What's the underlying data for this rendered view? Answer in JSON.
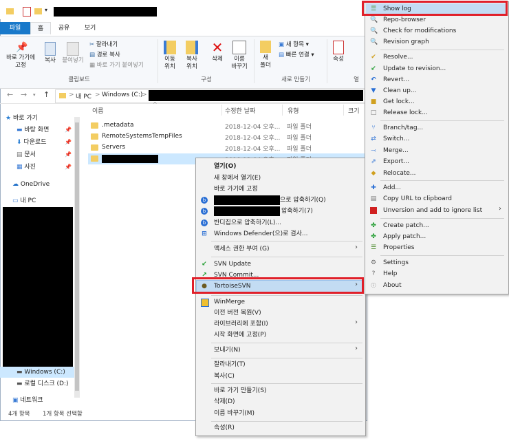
{
  "ribbon": {
    "tabs": [
      "파일",
      "홈",
      "공유",
      "보기"
    ],
    "pin_label": "바로 가기에\n고정",
    "copy_label": "복사",
    "paste_label": "붙여넣기",
    "cut_label": "잘라내기",
    "copy_path_label": "경로 복사",
    "paste_shortcut_label": "바로 가기 붙여넣기",
    "clipboard_group": "클립보드",
    "move_label": "이동\n위치",
    "copyto_label": "복사\n위치",
    "delete_label": "삭제",
    "rename_label": "이름\n바꾸기",
    "organize_group": "구성",
    "new_folder_label": "새\n폴더",
    "new_item_label": "새 항목",
    "easy_access_label": "빠른 연결",
    "new_group": "새로 만들기",
    "properties_label": "속성",
    "open_group": "열"
  },
  "address": {
    "crumbs": [
      "내 PC",
      "Windows (C:)"
    ],
    "sep": ">"
  },
  "nav": {
    "quick_access": "바로 가기",
    "desktop": "바탕 화면",
    "downloads": "다운로드",
    "documents": "문서",
    "pictures": "사진",
    "onedrive": "OneDrive",
    "this_pc": "내 PC",
    "windows_c": "Windows (C:)",
    "local_d": "로컬 디스크 (D:)",
    "network": "네트워크"
  },
  "columns": {
    "name": "이름",
    "modified": "수정한 날짜",
    "type": "유형",
    "size": "크기"
  },
  "files": [
    {
      "name": ".metadata",
      "date": "2018-12-04 오후...",
      "type": "파일 폴더"
    },
    {
      "name": "RemoteSystemsTempFiles",
      "date": "2018-12-04 오후...",
      "type": "파일 폴더"
    },
    {
      "name": "Servers",
      "date": "2018-12-04 오후...",
      "type": "파일 폴더"
    },
    {
      "name": "",
      "date": "2018-12-04 오후...",
      "type": "파일 폴더"
    }
  ],
  "status": {
    "count": "4개 항목",
    "selected": "1개 항목 선택함"
  },
  "context_menu": {
    "open": "열기(O)",
    "open_new": "새 창에서 열기(E)",
    "pin_quick": "바로 가기에 고정",
    "zip1_suffix": "으로 압축하기(Q)",
    "zip2_suffix": "압축하기(7)",
    "bandizip": "반디집으로 압축하기(L)...",
    "defender": "Windows Defender(으)로 검사...",
    "access": "액세스 권한 부여 (G)",
    "svn_update": "SVN Update",
    "svn_commit": "SVN Commit...",
    "tortoise": "TortoiseSVN",
    "winmerge": "WinMerge",
    "restore": "이전 버전 복원(V)",
    "library": "라이브러리에 포함(I)",
    "pin_start": "시작 화면에 고정(P)",
    "send_to": "보내기(N)",
    "cut": "잘라내기(T)",
    "copy": "복사(C)",
    "shortcut": "바로 가기 만들기(S)",
    "delete": "삭제(D)",
    "rename": "이름 바꾸기(M)",
    "properties": "속성(R)"
  },
  "svn_menu": {
    "show_log": "Show log",
    "repo_browser": "Repo-browser",
    "check_mods": "Check for modifications",
    "rev_graph": "Revision graph",
    "resolve": "Resolve...",
    "update_rev": "Update to revision...",
    "revert": "Revert...",
    "cleanup": "Clean up...",
    "get_lock": "Get lock...",
    "release_lock": "Release lock...",
    "branch": "Branch/tag...",
    "switch": "Switch...",
    "merge": "Merge...",
    "export": "Export...",
    "relocate": "Relocate...",
    "add": "Add...",
    "copy_url": "Copy URL to clipboard",
    "unversion": "Unversion and add to ignore list",
    "create_patch": "Create patch...",
    "apply_patch": "Apply patch...",
    "properties": "Properties",
    "settings": "Settings",
    "help": "Help",
    "about": "About"
  },
  "colors": {
    "accent": "#1979ca",
    "highlight": "#e0202a",
    "selected_row": "#cce8ff"
  }
}
